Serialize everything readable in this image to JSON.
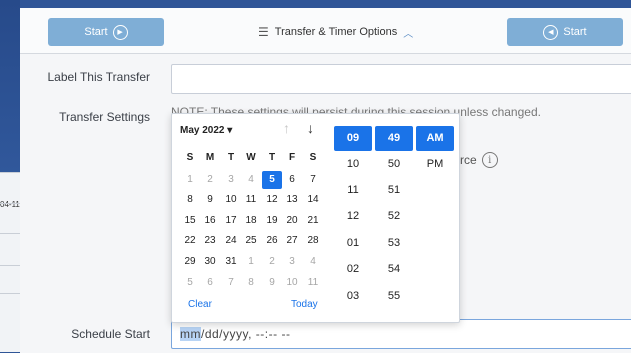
{
  "background": {
    "date_fragment": "04-11"
  },
  "header": {
    "start_left": "Start",
    "options": "Transfer & Timer Options",
    "start_right": "Start"
  },
  "form": {
    "label_transfer": "Label This Transfer",
    "transfer_settings": "Transfer Settings",
    "note": "NOTE: These settings will persist during this session unless changed.",
    "source_fragment": "rce",
    "schedule_start": "Schedule Start",
    "schedule_placeholder_mm": "mm",
    "schedule_placeholder_rest": "/dd/yyyy, --:-- --"
  },
  "picker": {
    "month_label": "May 2022 ▾",
    "weekdays": [
      "S",
      "M",
      "T",
      "W",
      "T",
      "F",
      "S"
    ],
    "weeks": [
      [
        "1",
        "2",
        "3",
        "4",
        "5",
        "6",
        "7"
      ],
      [
        "8",
        "9",
        "10",
        "11",
        "12",
        "13",
        "14"
      ],
      [
        "15",
        "16",
        "17",
        "18",
        "19",
        "20",
        "21"
      ],
      [
        "22",
        "23",
        "24",
        "25",
        "26",
        "27",
        "28"
      ],
      [
        "29",
        "30",
        "31",
        "1",
        "2",
        "3",
        "4"
      ],
      [
        "5",
        "6",
        "7",
        "8",
        "9",
        "10",
        "11"
      ]
    ],
    "selected_day": "5",
    "clear": "Clear",
    "today": "Today",
    "hours": [
      "09",
      "10",
      "11",
      "12",
      "01",
      "02",
      "03"
    ],
    "minutes": [
      "49",
      "50",
      "51",
      "52",
      "53",
      "54",
      "55"
    ],
    "ampm": [
      "AM",
      "PM"
    ]
  },
  "colors": {
    "accent": "#1a73e8",
    "button": "#7faed6",
    "bg": "#2f5597"
  }
}
